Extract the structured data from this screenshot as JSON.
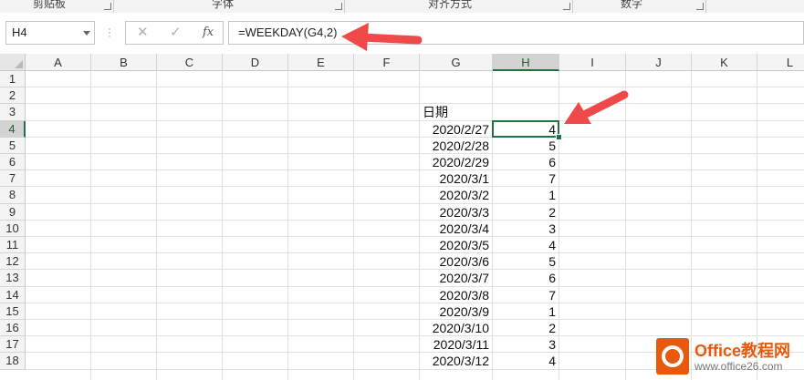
{
  "ribbon": {
    "groups": [
      "剪贴板",
      "字体",
      "对齐方式",
      "数字"
    ]
  },
  "formula_bar": {
    "name_box": "H4",
    "cancel_icon": "✕",
    "enter_icon": "✓",
    "fx_label": "fx",
    "formula": "=WEEKDAY(G4,2)"
  },
  "columns": [
    "A",
    "B",
    "C",
    "D",
    "E",
    "F",
    "G",
    "H",
    "I",
    "J",
    "K",
    "L"
  ],
  "rows": [
    "1",
    "2",
    "3",
    "4",
    "5",
    "6",
    "7",
    "8",
    "9",
    "10",
    "11",
    "12",
    "13",
    "14",
    "15",
    "16",
    "17",
    "18"
  ],
  "selected_cell": {
    "column": "H",
    "row": "4"
  },
  "sheet": {
    "header_label": "日期",
    "dates": [
      "2020/2/27",
      "2020/2/28",
      "2020/2/29",
      "2020/3/1",
      "2020/3/2",
      "2020/3/3",
      "2020/3/4",
      "2020/3/5",
      "2020/3/6",
      "2020/3/7",
      "2020/3/8",
      "2020/3/9",
      "2020/3/10",
      "2020/3/11",
      "2020/3/12"
    ],
    "weekdays": [
      "4",
      "5",
      "6",
      "7",
      "1",
      "2",
      "3",
      "4",
      "5",
      "6",
      "7",
      "1",
      "2",
      "3",
      "4"
    ]
  },
  "watermark": {
    "title": "Office教程网",
    "url": "www.office26.com"
  },
  "colors": {
    "accent": "#217346",
    "arrow": "#ee4a4a",
    "logo": "#e8590c"
  }
}
